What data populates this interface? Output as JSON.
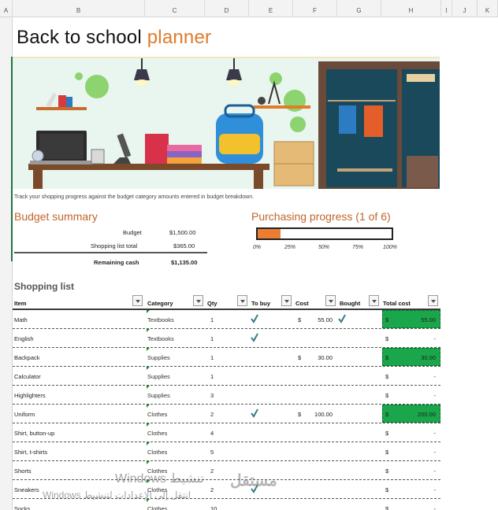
{
  "columns": [
    "A",
    "B",
    "C",
    "D",
    "E",
    "F",
    "G",
    "H",
    "I",
    "J",
    "K"
  ],
  "title": {
    "part1": "Back to school ",
    "part2": "planner"
  },
  "intro": "Track your shopping progress against the budget category amounts entered in budget breakdown.",
  "budget_summary": {
    "heading": "Budget summary",
    "budget_label": "Budget",
    "budget_value": "$1,500.00",
    "total_label": "Shopping list total",
    "total_value": "$365.00",
    "remaining_label": "Remaining cash",
    "remaining_value": "$1,135.00"
  },
  "purchasing_progress": {
    "heading": "Purchasing progress (1 of 6)",
    "fraction": 0.17,
    "ticks": [
      "0%",
      "25%",
      "50%",
      "75%",
      "100%"
    ]
  },
  "shopping_list": {
    "title": "Shopping list",
    "headers": {
      "item": "Item",
      "category": "Category",
      "qty": "Qty",
      "to_buy": "To buy",
      "cost": "Cost",
      "bought": "Bought",
      "total": "Total cost"
    },
    "rows": [
      {
        "item": "Math",
        "category": "Textbooks",
        "qty": "1",
        "to_buy": true,
        "cost_sym": "$",
        "cost": "55.00",
        "bought": true,
        "total_sym": "$",
        "total": "55.00",
        "highlight": true
      },
      {
        "item": "English",
        "category": "Textbooks",
        "qty": "1",
        "to_buy": true,
        "cost_sym": "",
        "cost": "",
        "bought": false,
        "total_sym": "$",
        "total": "-",
        "highlight": false
      },
      {
        "item": "Backpack",
        "category": "Supplies",
        "qty": "1",
        "to_buy": false,
        "cost_sym": "$",
        "cost": "30.00",
        "bought": false,
        "total_sym": "$",
        "total": "30.00",
        "highlight": true
      },
      {
        "item": "Calculator",
        "category": "Supplies",
        "qty": "1",
        "to_buy": false,
        "cost_sym": "",
        "cost": "",
        "bought": false,
        "total_sym": "$",
        "total": "-",
        "highlight": false
      },
      {
        "item": "Highlighters",
        "category": "Supplies",
        "qty": "3",
        "to_buy": false,
        "cost_sym": "",
        "cost": "",
        "bought": false,
        "total_sym": "$",
        "total": "-",
        "highlight": false
      },
      {
        "item": "Uniform",
        "category": "Clothes",
        "qty": "2",
        "to_buy": true,
        "cost_sym": "$",
        "cost": "100.00",
        "bought": false,
        "total_sym": "$",
        "total": "200.00",
        "highlight": true
      },
      {
        "item": "Shirt, button-up",
        "category": "Clothes",
        "qty": "4",
        "to_buy": false,
        "cost_sym": "",
        "cost": "",
        "bought": false,
        "total_sym": "$",
        "total": "-",
        "highlight": false
      },
      {
        "item": "Shirt, t-shirts",
        "category": "Clothes",
        "qty": "5",
        "to_buy": false,
        "cost_sym": "",
        "cost": "",
        "bought": false,
        "total_sym": "$",
        "total": "-",
        "highlight": false
      },
      {
        "item": "Shorts",
        "category": "Clothes",
        "qty": "2",
        "to_buy": false,
        "cost_sym": "",
        "cost": "",
        "bought": false,
        "total_sym": "$",
        "total": "-",
        "highlight": false
      },
      {
        "item": "Sneakers",
        "category": "Clothes",
        "qty": "2",
        "to_buy": true,
        "cost_sym": "",
        "cost": "",
        "bought": false,
        "total_sym": "$",
        "total": "-",
        "highlight": false
      },
      {
        "item": "Socks",
        "category": "Clothes",
        "qty": "10",
        "to_buy": false,
        "cost_sym": "",
        "cost": "",
        "bought": false,
        "total_sym": "$",
        "total": "-",
        "highlight": false
      }
    ]
  },
  "watermark": {
    "line1": "Windows تنشيط",
    "line2": "Windows انتقل إلى الإعدادات لتنشيط",
    "logo": "مستقل"
  },
  "colors": {
    "accent": "#e07b2a",
    "progress": "#ec7d31",
    "highlight": "#1aa64a",
    "excel_green": "#217346"
  }
}
